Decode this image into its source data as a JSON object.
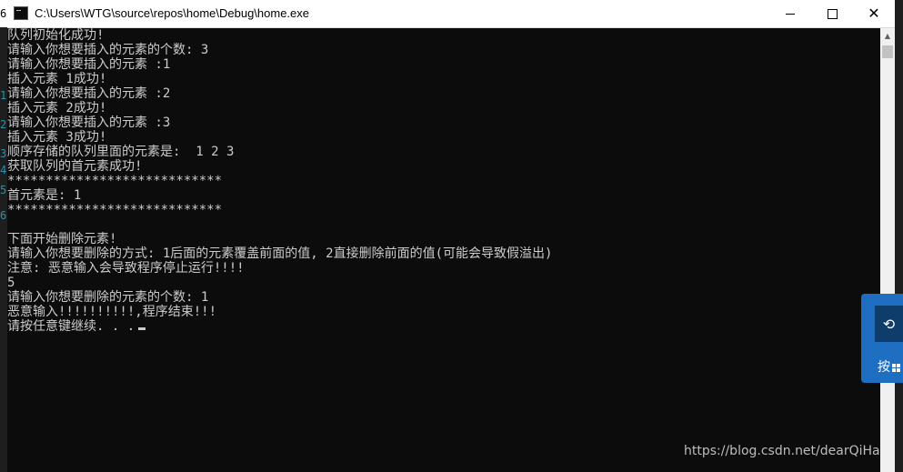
{
  "window": {
    "title": "C:\\Users\\WTG\\source\\repos\\home\\Debug\\home.exe"
  },
  "gutter": {
    "top_digit": "6",
    "digits": [
      "1",
      "2",
      "3",
      "4",
      "5",
      "6"
    ]
  },
  "console": {
    "lines": [
      "队列初始化成功!",
      "请输入你想要插入的元素的个数: 3",
      "请输入你想要插入的元素 :1",
      "插入元素 1成功!",
      "请输入你想要插入的元素 :2",
      "插入元素 2成功!",
      "请输入你想要插入的元素 :3",
      "插入元素 3成功!",
      "顺序存储的队列里面的元素是:  1 2 3",
      "获取队列的首元素成功!",
      "****************************",
      "首元素是: 1",
      "****************************",
      "",
      "下面开始删除元素!",
      "请输入你想要删除的方式: 1后面的元素覆盖前面的值, 2直接删除前面的值(可能会导致假溢出)",
      "注意: 恶意输入会导致程序停止运行!!!!",
      "5",
      "请输入你想要删除的元素的个数: 1",
      "恶意输入!!!!!!!!!!,程序结束!!!",
      "请按任意键继续. . ."
    ]
  },
  "side_widget": {
    "label": "按"
  },
  "watermark": "https://blog.csdn.net/dearQiHa",
  "icons": {
    "app": "console-app-icon",
    "minimize": "minimize-icon",
    "maximize": "maximize-icon",
    "close": "close-icon",
    "widget": "rotate-icon",
    "windows": "windows-logo-icon"
  },
  "colors": {
    "console_bg": "#0c0c0c",
    "console_text": "#cccccc",
    "titlebar_bg": "#ffffff",
    "widget_blue": "#1e6fc1"
  }
}
